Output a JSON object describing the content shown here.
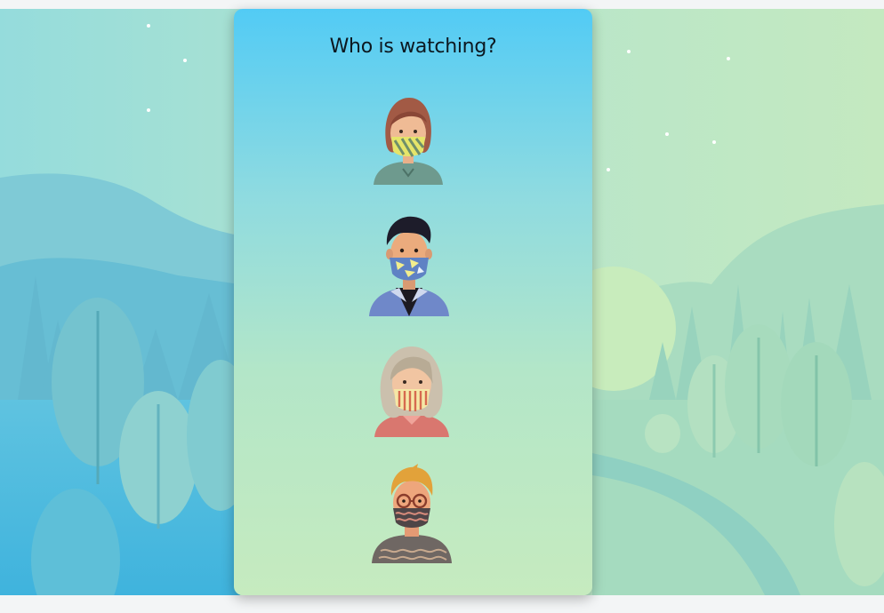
{
  "heading": "Who is watching?",
  "profiles": [
    {
      "icon": "avatar-woman-brown-hair-striped-mask"
    },
    {
      "icon": "avatar-man-dark-hair-triangle-mask"
    },
    {
      "icon": "avatar-elderly-woman-striped-mask"
    },
    {
      "icon": "avatar-man-glasses-wavy-mask"
    }
  ],
  "colors": {
    "panel_top": "#52cbf5",
    "panel_bottom": "#c6ebbf",
    "background_left": "#8fd8e0",
    "background_right": "#bfe6c2"
  }
}
